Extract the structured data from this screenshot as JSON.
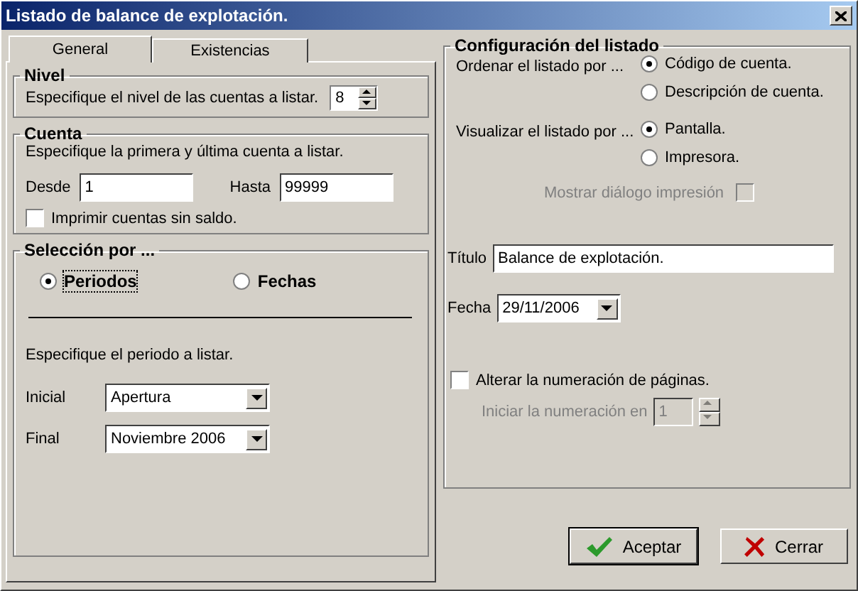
{
  "window": {
    "title": "Listado de balance de explotación."
  },
  "tabs": [
    {
      "label": "General",
      "selected": true
    },
    {
      "label": "Existencias",
      "selected": false
    }
  ],
  "nivel": {
    "title": "Nivel",
    "label": "Especifique el nivel de las cuentas a listar.",
    "value": "8"
  },
  "cuenta": {
    "title": "Cuenta",
    "instruction": "Especifique la primera y última cuenta a listar.",
    "from_label": "Desde",
    "from_value": "1",
    "to_label": "Hasta",
    "to_value": "99999",
    "checkbox": {
      "label": "Imprimir cuentas sin saldo.",
      "checked": false
    }
  },
  "seleccion": {
    "title": "Selección por ...",
    "options": [
      {
        "label": "Periodos",
        "selected": true
      },
      {
        "label": "Fechas",
        "selected": false
      }
    ],
    "instruction": "Especifique el periodo a listar.",
    "fields": [
      {
        "label": "Inicial",
        "value": "Apertura"
      },
      {
        "label": "Final",
        "value": "Noviembre 2006"
      }
    ]
  },
  "config": {
    "title": "Configuración del listado",
    "groups": [
      {
        "label": "Ordenar el listado por ...",
        "options": [
          {
            "label": "Código de cuenta.",
            "selected": true
          },
          {
            "label": "Descripción de cuenta.",
            "selected": false
          }
        ]
      },
      {
        "label": "Visualizar el listado por ...",
        "options": [
          {
            "label": "Pantalla.",
            "selected": true
          },
          {
            "label": "Impresora.",
            "selected": false
          }
        ]
      }
    ],
    "print_dialog": {
      "label": "Mostrar diálogo impresión",
      "checked": false,
      "disabled": true
    },
    "title_field": {
      "label": "Título",
      "value": "Balance de explotación."
    },
    "date_field": {
      "label": "Fecha",
      "value": "29/11/2006"
    },
    "renumber": {
      "label": "Alterar la numeración de páginas.",
      "checked": false
    },
    "start_number": {
      "label": "Iniciar la numeración en",
      "value": "1",
      "disabled": true
    }
  },
  "buttons": [
    {
      "label": "Aceptar",
      "kind": "ok"
    },
    {
      "label": "Cerrar",
      "kind": "close"
    }
  ]
}
